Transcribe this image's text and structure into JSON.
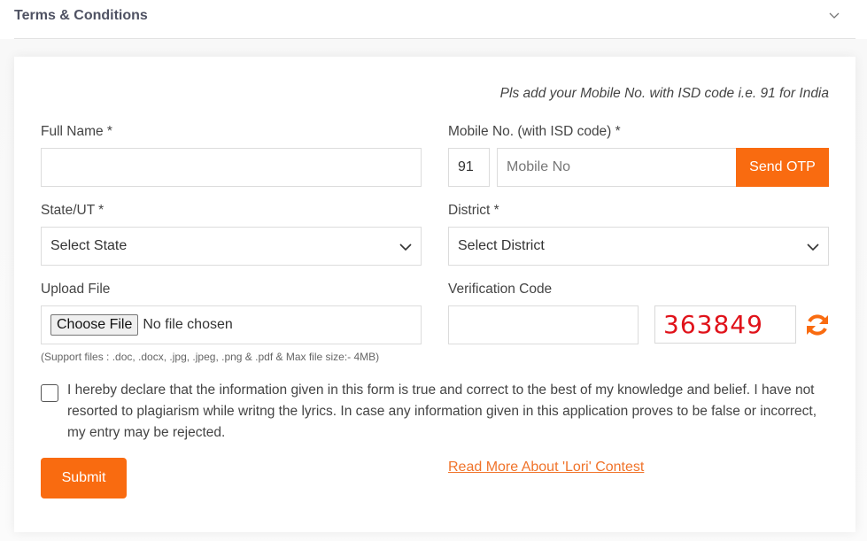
{
  "accordion": {
    "title": "Terms & Conditions",
    "chevron_icon": "chevron-down-icon"
  },
  "form": {
    "hint": "Pls add your Mobile No. with ISD code i.e. 91 for India",
    "full_name": {
      "label": "Full Name *",
      "value": ""
    },
    "mobile": {
      "label": "Mobile No. (with ISD code) *",
      "isd_value": "91",
      "placeholder": "Mobile No",
      "value": "",
      "send_otp_label": "Send OTP"
    },
    "state": {
      "label": "State/UT *",
      "selected": "Select State"
    },
    "district": {
      "label": "District *",
      "selected": "Select District"
    },
    "upload": {
      "label": "Upload File",
      "button_label": "Choose File",
      "status": "No file chosen",
      "support_note": "(Support files : .doc, .docx, .jpg, .jpeg, .png & .pdf & Max file size:- 4MB)"
    },
    "verification": {
      "label": "Verification Code",
      "value": "",
      "captcha": "363849",
      "refresh_icon": "refresh-icon"
    },
    "declaration": {
      "checked": false,
      "text": "I hereby declare that the information given in this form is true and correct to the best of my knowledge and belief. I have not resorted to plagiarism while writng the lyrics. In case any information given in this application proves to be false or incorrect, my entry may be rejected."
    },
    "submit_label": "Submit",
    "read_more_label": "Read More About 'Lori' Contest"
  },
  "colors": {
    "accent": "#f96b10",
    "captcha_text": "#e0121a",
    "link": "#f0732a",
    "accordion_title": "#4f5263"
  }
}
